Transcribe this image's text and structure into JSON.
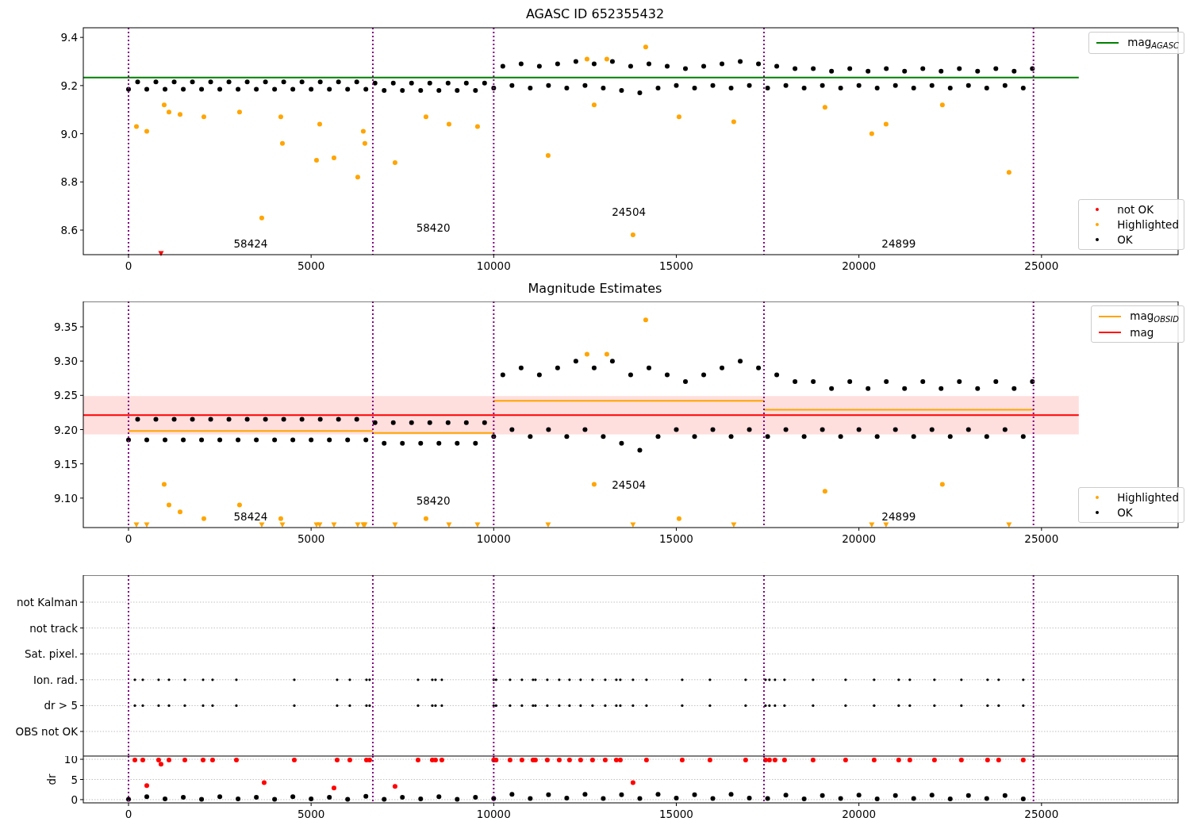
{
  "figure": {
    "panels": [
      {
        "title": "AGASC ID 652355432",
        "chart_data": {
          "type": "scatter",
          "xlim": [
            -1238,
            28740
          ],
          "ylim": [
            8.498,
            9.44
          ],
          "xticks": [
            0,
            5000,
            10000,
            15000,
            20000,
            25000
          ],
          "yticks": [
            {
              "value": 8.6,
              "label": "8.6"
            },
            {
              "value": 8.8,
              "label": "8.8"
            },
            {
              "value": 9,
              "label": "9.0"
            },
            {
              "value": 9.2,
              "label": "9.2"
            },
            {
              "value": 9.4,
              "label": "9.4"
            }
          ],
          "ref_lines": [
            {
              "axis": "x",
              "value": 0
            },
            {
              "axis": "x",
              "value": 6690
            },
            {
              "axis": "x",
              "value": 10000
            },
            {
              "axis": "x",
              "value": 17400
            },
            {
              "axis": "x",
              "value": 24780
            }
          ],
          "series": [
            {
              "name": "OK",
              "type": "scatter",
              "color": "#000000",
              "x": [
                0,
                250,
                500,
                750,
                1000,
                1250,
                1500,
                1750,
                2000,
                2250,
                2500,
                2750,
                3000,
                3250,
                3500,
                3750,
                4000,
                4250,
                4500,
                4750,
                5000,
                5250,
                5500,
                5750,
                6000,
                6250,
                6500,
                6750,
                7000,
                7250,
                7500,
                7750,
                8000,
                8250,
                8500,
                8750,
                9000,
                9250,
                9500,
                9750,
                10000,
                10250,
                10500,
                10750,
                11000,
                11250,
                11500,
                11750,
                12000,
                12250,
                12500,
                12750,
                13000,
                13250,
                13500,
                13750,
                14000,
                14250,
                14500,
                14750,
                15000,
                15250,
                15500,
                15750,
                16000,
                16250,
                16500,
                16750,
                17000,
                17250,
                17500,
                17750,
                18000,
                18250,
                18500,
                18750,
                19000,
                19250,
                19500,
                19750,
                20000,
                20250,
                20500,
                20750,
                21000,
                21250,
                21500,
                21750,
                22000,
                22250,
                22500,
                22750,
                23000,
                23250,
                23500,
                23750,
                24000,
                24250,
                24500,
                24750
              ],
              "values": [
                9.185,
                9.215,
                9.185,
                9.215,
                9.185,
                9.215,
                9.185,
                9.215,
                9.185,
                9.215,
                9.185,
                9.215,
                9.185,
                9.215,
                9.185,
                9.215,
                9.185,
                9.215,
                9.185,
                9.215,
                9.185,
                9.215,
                9.185,
                9.215,
                9.185,
                9.215,
                9.185,
                9.21,
                9.18,
                9.21,
                9.18,
                9.21,
                9.18,
                9.21,
                9.18,
                9.21,
                9.18,
                9.21,
                9.18,
                9.21,
                9.19,
                9.28,
                9.2,
                9.29,
                9.19,
                9.28,
                9.2,
                9.29,
                9.19,
                9.3,
                9.2,
                9.29,
                9.19,
                9.3,
                9.18,
                9.28,
                9.17,
                9.29,
                9.19,
                9.28,
                9.2,
                9.27,
                9.19,
                9.28,
                9.2,
                9.29,
                9.19,
                9.3,
                9.2,
                9.29,
                9.19,
                9.28,
                9.2,
                9.27,
                9.19,
                9.27,
                9.2,
                9.26,
                9.19,
                9.27,
                9.2,
                9.26,
                9.19,
                9.27,
                9.2,
                9.26,
                9.19,
                9.27,
                9.2,
                9.26,
                9.19,
                9.27,
                9.2,
                9.26,
                9.19,
                9.27,
                9.2,
                9.26,
                9.19,
                9.27
              ]
            },
            {
              "name": "Highlighted",
              "type": "scatter",
              "color": "#ffa500",
              "x": [
                217,
                500,
                977,
                1108,
                1412,
                2063,
                3040,
                3649,
                4170,
                4214,
                5148,
                5235,
                5626,
                6277,
                6429,
                6472,
                7298,
                8145,
                8775,
                9557,
                11490,
                12555,
                12750,
                13097,
                13814,
                14162,
                15075,
                16573,
                19071,
                20352,
                20743,
                22285,
                24110
              ],
              "values": [
                9.03,
                9.01,
                9.12,
                9.09,
                9.08,
                9.07,
                9.09,
                8.65,
                9.07,
                8.96,
                8.89,
                9.04,
                8.9,
                8.82,
                9.01,
                8.96,
                8.88,
                9.07,
                9.04,
                9.03,
                8.91,
                9.31,
                9.12,
                9.31,
                8.58,
                9.36,
                9.07,
                9.05,
                9.11,
                9.0,
                9.04,
                9.12,
                8.84
              ]
            },
            {
              "name": "not OK",
              "type": "scatter",
              "color": "#ff0000",
              "x": [
                890
              ],
              "values": [
                8.5
              ]
            },
            {
              "name": "mag$_{AGASC}$",
              "type": "line",
              "color": "#008000",
              "x": [
                -1238,
                26020
              ],
              "values": [
                9.233,
                9.233
              ]
            }
          ],
          "annotations": [
            "58424",
            "58420",
            "24504",
            "24899"
          ]
        }
      },
      {
        "title": "Magnitude Estimates",
        "chart_data": {
          "type": "scatter",
          "xlim": [
            -1238,
            28740
          ],
          "ylim": [
            9.057,
            9.387
          ],
          "xticks": [
            0,
            5000,
            10000,
            15000,
            20000,
            25000
          ],
          "yticks": [
            {
              "value": 9.1,
              "label": "9.10"
            },
            {
              "value": 9.15,
              "label": "9.15"
            },
            {
              "value": 9.2,
              "label": "9.20"
            },
            {
              "value": 9.25,
              "label": "9.25"
            },
            {
              "value": 9.3,
              "label": "9.30"
            },
            {
              "value": 9.35,
              "label": "9.35"
            }
          ],
          "ref_lines": [
            {
              "axis": "x",
              "value": 0
            },
            {
              "axis": "x",
              "value": 6690
            },
            {
              "axis": "x",
              "value": 10000
            },
            {
              "axis": "x",
              "value": 17400
            },
            {
              "axis": "x",
              "value": 24780
            }
          ],
          "bands": [
            {
              "axis": "y",
              "from": 9.193,
              "to": 9.249,
              "color": "#ffdede"
            }
          ],
          "series": [
            {
              "name": "OK",
              "type": "scatter",
              "color": "#000000",
              "x": [
                0,
                250,
                500,
                750,
                1000,
                1250,
                1500,
                1750,
                2000,
                2250,
                2500,
                2750,
                3000,
                3250,
                3500,
                3750,
                4000,
                4250,
                4500,
                4750,
                5000,
                5250,
                5500,
                5750,
                6000,
                6250,
                6500,
                6750,
                7000,
                7250,
                7500,
                7750,
                8000,
                8250,
                8500,
                8750,
                9000,
                9250,
                9500,
                9750,
                10000,
                10250,
                10500,
                10750,
                11000,
                11250,
                11500,
                11750,
                12000,
                12250,
                12500,
                12750,
                13000,
                13250,
                13500,
                13750,
                14000,
                14250,
                14500,
                14750,
                15000,
                15250,
                15500,
                15750,
                16000,
                16250,
                16500,
                16750,
                17000,
                17250,
                17500,
                17750,
                18000,
                18250,
                18500,
                18750,
                19000,
                19250,
                19500,
                19750,
                20000,
                20250,
                20500,
                20750,
                21000,
                21250,
                21500,
                21750,
                22000,
                22250,
                22500,
                22750,
                23000,
                23250,
                23500,
                23750,
                24000,
                24250,
                24500,
                24750
              ],
              "values": [
                9.185,
                9.215,
                9.185,
                9.215,
                9.185,
                9.215,
                9.185,
                9.215,
                9.185,
                9.215,
                9.185,
                9.215,
                9.185,
                9.215,
                9.185,
                9.215,
                9.185,
                9.215,
                9.185,
                9.215,
                9.185,
                9.215,
                9.185,
                9.215,
                9.185,
                9.215,
                9.185,
                9.21,
                9.18,
                9.21,
                9.18,
                9.21,
                9.18,
                9.21,
                9.18,
                9.21,
                9.18,
                9.21,
                9.18,
                9.21,
                9.19,
                9.28,
                9.2,
                9.29,
                9.19,
                9.28,
                9.2,
                9.29,
                9.19,
                9.3,
                9.2,
                9.29,
                9.19,
                9.3,
                9.18,
                9.28,
                9.17,
                9.29,
                9.19,
                9.28,
                9.2,
                9.27,
                9.19,
                9.28,
                9.2,
                9.29,
                9.19,
                9.3,
                9.2,
                9.29,
                9.19,
                9.28,
                9.2,
                9.27,
                9.19,
                9.27,
                9.2,
                9.26,
                9.19,
                9.27,
                9.2,
                9.26,
                9.19,
                9.27,
                9.2,
                9.26,
                9.19,
                9.27,
                9.2,
                9.26,
                9.19,
                9.27,
                9.2,
                9.26,
                9.19,
                9.27,
                9.2,
                9.26,
                9.19,
                9.27
              ]
            },
            {
              "name": "Highlighted",
              "type": "scatter",
              "color": "#ffa500",
              "x": [
                217,
                500,
                977,
                1108,
                1412,
                2063,
                3040,
                3649,
                4170,
                4214,
                5148,
                5235,
                5626,
                6277,
                6429,
                6472,
                7298,
                8145,
                8775,
                9557,
                11490,
                12555,
                12750,
                13097,
                13814,
                14162,
                15075,
                16573,
                19071,
                20352,
                20743,
                22285,
                24110
              ],
              "values": [
                9.06,
                9.06,
                9.12,
                9.09,
                9.08,
                9.07,
                9.09,
                9.06,
                9.07,
                9.06,
                9.06,
                9.06,
                9.06,
                9.06,
                9.06,
                9.06,
                9.06,
                9.07,
                9.06,
                9.06,
                9.06,
                9.31,
                9.12,
                9.31,
                9.06,
                9.36,
                9.07,
                9.06,
                9.11,
                9.06,
                9.06,
                9.12,
                9.06
              ]
            },
            {
              "name": "mag$_{OBSID}$",
              "type": "line",
              "color": "#ffa500",
              "x": [
                0,
                6690,
                null,
                6690,
                10000,
                null,
                10000,
                17400,
                null,
                17400,
                24780
              ],
              "values": [
                9.198,
                9.198,
                null,
                9.195,
                9.195,
                null,
                9.242,
                9.242,
                null,
                9.229,
                9.229
              ]
            },
            {
              "name": "mag",
              "type": "line",
              "color": "#ff0000",
              "x": [
                -1238,
                26020
              ],
              "values": [
                9.221,
                9.221
              ]
            }
          ],
          "annotations": [
            "58424",
            "58420",
            "24504",
            "24899"
          ]
        }
      },
      {
        "flag_rows": [
          "not Kalman",
          "not track",
          "Sat. pixel.",
          "Ion. rad.",
          "dr > 5",
          "OBS not OK"
        ]
      },
      {
        "chart_data": {
          "type": "scatter",
          "xlim": [
            -1238,
            28740
          ],
          "ylim": [
            -0.8,
            10.8
          ],
          "grid": true,
          "ylabel": "dr",
          "xticks": [
            0,
            5000,
            10000,
            15000,
            20000,
            25000
          ],
          "yticks": [
            {
              "value": 0,
              "label": "0"
            },
            {
              "value": 5,
              "label": "5"
            },
            {
              "value": 10,
              "label": "10"
            }
          ],
          "ref_lines": [
            {
              "axis": "x",
              "value": 0
            },
            {
              "axis": "x",
              "value": 6690
            },
            {
              "axis": "x",
              "value": 10000
            },
            {
              "axis": "x",
              "value": 17400
            },
            {
              "axis": "x",
              "value": 24780
            }
          ],
          "series": [
            {
              "type": "scatter",
              "color": "#000000",
              "x": [
                0,
                500,
                1000,
                1500,
                2000,
                2500,
                3000,
                3500,
                4000,
                4500,
                5000,
                5500,
                6000,
                6500,
                7000,
                7500,
                8000,
                8500,
                9000,
                9500,
                10000,
                10500,
                11000,
                11500,
                12000,
                12500,
                13000,
                13500,
                14000,
                14500,
                15000,
                15500,
                16000,
                16500,
                17000,
                17500,
                18000,
                18500,
                19000,
                19500,
                20000,
                20500,
                21000,
                21500,
                22000,
                22500,
                23000,
                23500,
                24000,
                24500
              ],
              "values": [
                0.1,
                0.7,
                0.2,
                0.6,
                0.1,
                0.7,
                0.2,
                0.6,
                0.1,
                0.7,
                0.2,
                0.6,
                0.1,
                0.8,
                0.1,
                0.6,
                0.2,
                0.7,
                0.1,
                0.6,
                0.3,
                1.3,
                0.3,
                1.2,
                0.4,
                1.3,
                0.3,
                1.2,
                0.3,
                1.3,
                0.4,
                1.2,
                0.3,
                1.3,
                0.4,
                0.3,
                1.1,
                0.2,
                1.0,
                0.3,
                1.1,
                0.2,
                1.0,
                0.3,
                1.1,
                0.2,
                1.0,
                0.3,
                1.0,
                0.2
              ]
            },
            {
              "type": "scatter",
              "color": "#ff0000",
              "x": [
                174,
                391,
                825,
                1108,
                1542,
                2042,
                2302,
                2954,
                4540,
                5712,
                6060,
                6516,
                6603,
                7928,
                8319,
                8406,
                8580,
                10000,
                10065,
                10447,
                10773,
                11077,
                11142,
                11468,
                11794,
                12076,
                12380,
                12706,
                13054,
                13358,
                13467,
                14183,
                15161,
                15921,
                16898,
                17442,
                17550,
                17702,
                17963,
                18745,
                19635,
                20417,
                21090,
                21394,
                22068,
                22806,
                23523,
                23827,
                24500,
                500,
                890,
                3714,
                5626,
                7298,
                13814
              ],
              "values": [
                9.8,
                9.8,
                9.8,
                9.8,
                9.8,
                9.8,
                9.8,
                9.8,
                9.8,
                9.8,
                9.8,
                9.8,
                9.8,
                9.8,
                9.8,
                9.8,
                9.8,
                9.8,
                9.8,
                9.8,
                9.8,
                9.8,
                9.8,
                9.8,
                9.8,
                9.8,
                9.8,
                9.8,
                9.8,
                9.8,
                9.8,
                9.8,
                9.8,
                9.8,
                9.8,
                9.8,
                9.8,
                9.8,
                9.8,
                9.8,
                9.8,
                9.8,
                9.8,
                9.8,
                9.8,
                9.8,
                9.8,
                9.8,
                9.8,
                3.5,
                8.8,
                4.2,
                2.9,
                3.3,
                4.2
              ]
            }
          ]
        }
      }
    ]
  }
}
